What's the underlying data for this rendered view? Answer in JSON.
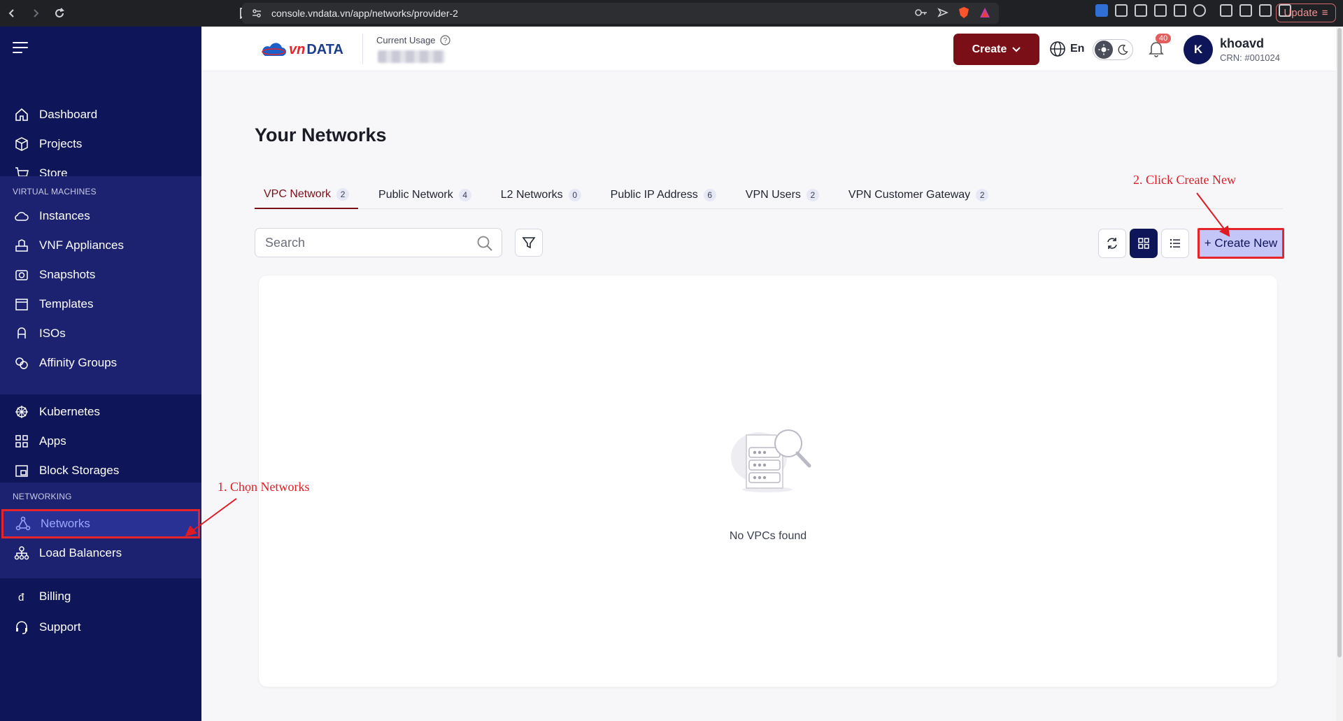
{
  "browser": {
    "url": "console.vndata.vn/app/networks/provider-2",
    "update_label": "Update"
  },
  "sidebar": {
    "top_items": [
      {
        "label": "Dashboard",
        "icon": "home-icon"
      },
      {
        "label": "Projects",
        "icon": "cube-icon"
      },
      {
        "label": "Store",
        "icon": "cart-icon"
      }
    ],
    "vm_section": "VIRTUAL MACHINES",
    "vm_items": [
      {
        "label": "Instances",
        "icon": "cloud-icon"
      },
      {
        "label": "VNF Appliances",
        "icon": "appliance-icon"
      },
      {
        "label": "Snapshots",
        "icon": "camera-icon"
      },
      {
        "label": "Templates",
        "icon": "template-icon"
      },
      {
        "label": "ISOs",
        "icon": "iso-icon"
      },
      {
        "label": "Affinity Groups",
        "icon": "affinity-icon"
      }
    ],
    "mid_items": [
      {
        "label": "Kubernetes",
        "icon": "kubernetes-icon"
      },
      {
        "label": "Apps",
        "icon": "apps-icon"
      },
      {
        "label": "Block Storages",
        "icon": "storage-icon"
      }
    ],
    "net_section": "NETWORKING",
    "net_items": [
      {
        "label": "Networks",
        "icon": "network-icon"
      },
      {
        "label": "Load Balancers",
        "icon": "load-balancer-icon"
      }
    ],
    "bottom_items": [
      {
        "label": "Billing",
        "icon": "billing-icon"
      },
      {
        "label": "Support",
        "icon": "support-icon"
      }
    ]
  },
  "header": {
    "logo_vn": "vn",
    "logo_data": "DATA",
    "current_usage_label": "Current Usage",
    "create_label": "Create",
    "language": "En",
    "notification_count": "40",
    "avatar_initial": "K",
    "user_name": "khoavd",
    "user_crn": "CRN: #001024"
  },
  "main": {
    "title": "Your Networks",
    "tabs": [
      {
        "label": "VPC Network",
        "count": "2"
      },
      {
        "label": "Public Network",
        "count": "4"
      },
      {
        "label": "L2 Networks",
        "count": "0"
      },
      {
        "label": "Public IP Address",
        "count": "6"
      },
      {
        "label": "VPN Users",
        "count": "2"
      },
      {
        "label": "VPN Customer Gateway",
        "count": "2"
      }
    ],
    "search_placeholder": "Search",
    "create_new_label": "+ Create New",
    "empty_message": "No VPCs found"
  },
  "annotations": {
    "step1": "1. Chọn Networks",
    "step2": "2. Click Create New",
    "color": "#e01a22"
  }
}
